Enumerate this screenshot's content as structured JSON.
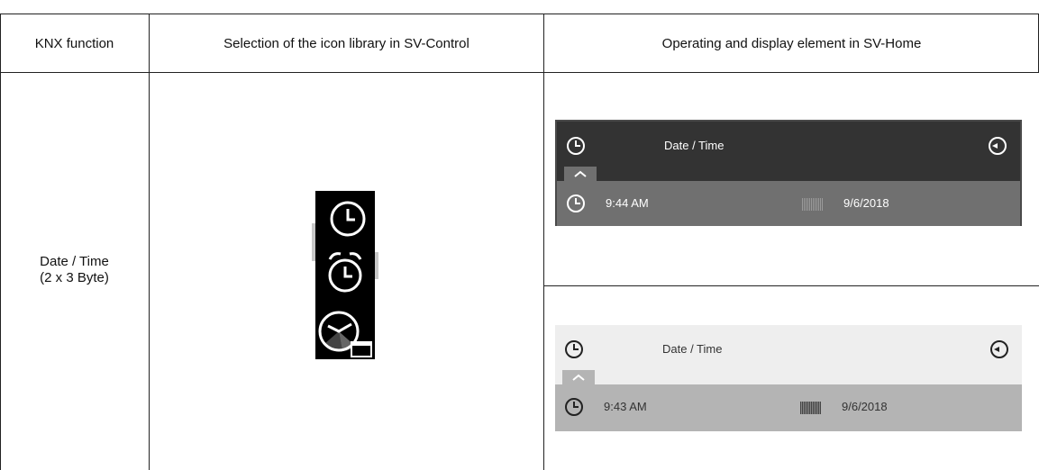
{
  "table": {
    "headers": [
      "KNX function",
      "Selection of the icon library in SV-Control",
      "Operating and display element in SV-Home"
    ],
    "row": {
      "knx_function_line1": "Date / Time",
      "knx_function_line2": "(2 x 3 Byte)"
    }
  },
  "icons": [
    "clock-icon",
    "alarm-clock-icon",
    "clock-calendar-icon"
  ],
  "widgets": [
    {
      "theme": "dark",
      "title": "Date / Time",
      "time": "9:44 AM",
      "date": "9/6/2018"
    },
    {
      "theme": "light",
      "title": "Date / Time",
      "time": "9:43 AM",
      "date": "9/6/2018"
    }
  ],
  "colors": {
    "dark_header": "#333333",
    "dark_row": "#707070",
    "light_header": "#eeeeee",
    "light_row": "#b4b4b4"
  }
}
